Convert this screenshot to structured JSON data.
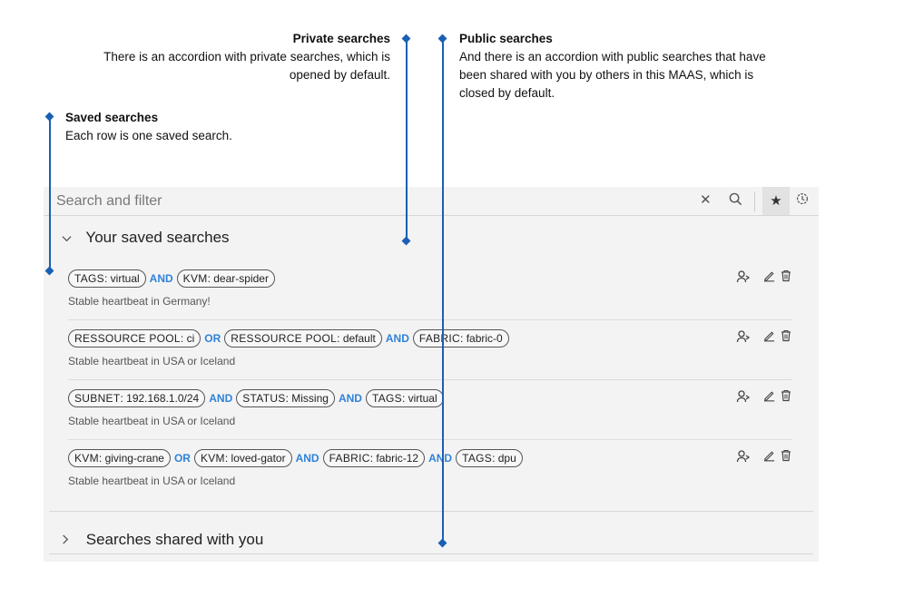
{
  "annotations": {
    "private": {
      "title": "Private searches",
      "text": "There is an accordion with private searches, which is opened by default."
    },
    "public": {
      "title": "Public searches",
      "text": "And there is an accordion with public searches that have been shared with you by others in this MAAS, which is closed by default."
    },
    "saved": {
      "title": "Saved searches",
      "text": "Each row is one saved search."
    }
  },
  "search": {
    "placeholder": "Search and filter"
  },
  "icons": {
    "clear": "close-icon",
    "search": "search-icon",
    "saved": "star-icon",
    "recent": "clock-icon"
  },
  "accordions": {
    "saved": {
      "label": "Your saved searches",
      "expanded": true
    },
    "shared": {
      "label": "Searches shared with you",
      "expanded": false
    }
  },
  "saved_searches": [
    {
      "terms": [
        {
          "key": "TAGS",
          "value": "virtual"
        },
        {
          "op": "AND"
        },
        {
          "key": "KVM",
          "value": "dear-spider"
        }
      ],
      "description": "Stable heartbeat in Germany!"
    },
    {
      "terms": [
        {
          "key": "RESSOURCE POOL",
          "value": "ci"
        },
        {
          "op": "OR"
        },
        {
          "key": "RESSOURCE POOL",
          "value": "default"
        },
        {
          "op": "AND"
        },
        {
          "key": "FABRIC",
          "value": "fabric-0"
        }
      ],
      "description": "Stable heartbeat in USA or Iceland"
    },
    {
      "terms": [
        {
          "key": "SUBNET",
          "value": "192.168.1.0/24"
        },
        {
          "op": "AND"
        },
        {
          "key": "STATUS",
          "value": "Missing"
        },
        {
          "op": "AND"
        },
        {
          "key": "TAGS",
          "value": "virtual"
        }
      ],
      "description": "Stable heartbeat in USA or Iceland"
    },
    {
      "terms": [
        {
          "key": "KVM",
          "value": "giving-crane"
        },
        {
          "op": "OR"
        },
        {
          "key": "KVM",
          "value": "loved-gator"
        },
        {
          "op": "AND"
        },
        {
          "key": "FABRIC",
          "value": "fabric-12"
        },
        {
          "op": "AND"
        },
        {
          "key": "TAGS",
          "value": "dpu"
        }
      ],
      "description": "Stable heartbeat in USA or Iceland"
    }
  ],
  "colors": {
    "annotation": "#1a5fb4",
    "operator": "#2f82d9",
    "panel": "#f3f3f3"
  }
}
